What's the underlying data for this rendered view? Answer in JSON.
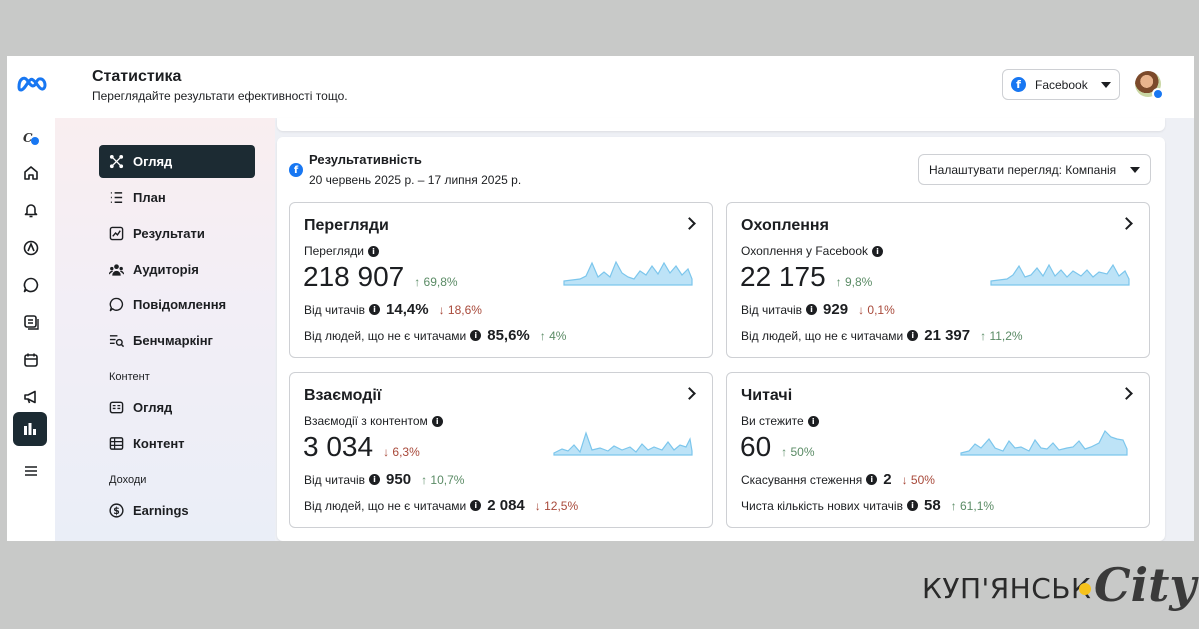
{
  "header": {
    "title": "Статистика",
    "subtitle": "Переглядайте результати ефективності тощо.",
    "platform_select": "Facebook"
  },
  "nav": {
    "items": [
      {
        "label": "Огляд",
        "icon": "overview-icon",
        "active": true
      },
      {
        "label": "План",
        "icon": "list-icon",
        "active": false
      },
      {
        "label": "Результати",
        "icon": "trend-icon",
        "active": false
      },
      {
        "label": "Аудиторія",
        "icon": "audience-icon",
        "active": false
      },
      {
        "label": "Повідомлення",
        "icon": "chat-icon",
        "active": false
      },
      {
        "label": "Бенчмаркінг",
        "icon": "benchmark-icon",
        "active": false
      }
    ],
    "section_content": "Контент",
    "content_items": [
      {
        "label": "Огляд",
        "icon": "content-overview-icon"
      },
      {
        "label": "Контент",
        "icon": "table-icon"
      }
    ],
    "section_income": "Доходи",
    "income_items": [
      {
        "label": "Earnings",
        "icon": "dollar-icon"
      }
    ]
  },
  "panel": {
    "title": "Результативність",
    "date_range": "20 червень 2025 р. – 17 липня 2025 р.",
    "view_select": "Налаштувати перегляд: Компанія"
  },
  "cards": [
    {
      "title": "Перегляди",
      "metric_label": "Перегляди",
      "value": "218 907",
      "delta": "↑ 69,8%",
      "delta_dir": "up",
      "row1_label": "Від читачів",
      "row1_value": "14,4%",
      "row1_delta": "↓ 18,6%",
      "row1_dir": "down",
      "row2_label": "Від людей, що не є читачами",
      "row2_value": "85,6%",
      "row2_delta": "↑ 4%",
      "row2_dir": "up"
    },
    {
      "title": "Охоплення",
      "metric_label": "Охоплення у Facebook",
      "value": "22 175",
      "delta": "↑ 9,8%",
      "delta_dir": "up",
      "row1_label": "Від читачів",
      "row1_value": "929",
      "row1_delta": "↓ 0,1%",
      "row1_dir": "down",
      "row2_label": "Від людей, що не є читачами",
      "row2_value": "21 397",
      "row2_delta": "↑ 11,2%",
      "row2_dir": "up"
    },
    {
      "title": "Взаємодії",
      "metric_label": "Взаємодії з контентом",
      "value": "3 034",
      "delta": "↓ 6,3%",
      "delta_dir": "down",
      "row1_label": "Від читачів",
      "row1_value": "950",
      "row1_delta": "↑ 10,7%",
      "row1_dir": "up",
      "row2_label": "Від людей, що не є читачами",
      "row2_value": "2 084",
      "row2_delta": "↓ 12,5%",
      "row2_dir": "down"
    },
    {
      "title": "Читачі",
      "metric_label": "Ви стежите",
      "value": "60",
      "delta": "↑ 50%",
      "delta_dir": "up",
      "row1_label": "Скасування стеження",
      "row1_value": "2",
      "row1_delta": "↓ 50%",
      "row1_dir": "down",
      "row2_label": "Чиста кількість нових читачів",
      "row2_value": "58",
      "row2_delta": "↑ 61,1%",
      "row2_dir": "up"
    }
  ],
  "watermark": {
    "text": "КУП'ЯНСЬК",
    "script": "City"
  },
  "colors": {
    "accent": "#1877f2",
    "active_nav": "#1c2b33",
    "spark_fill": "#bde3f7",
    "spark_line": "#7cc6ec",
    "up": "#31a24c",
    "down": "#e41e3f"
  }
}
